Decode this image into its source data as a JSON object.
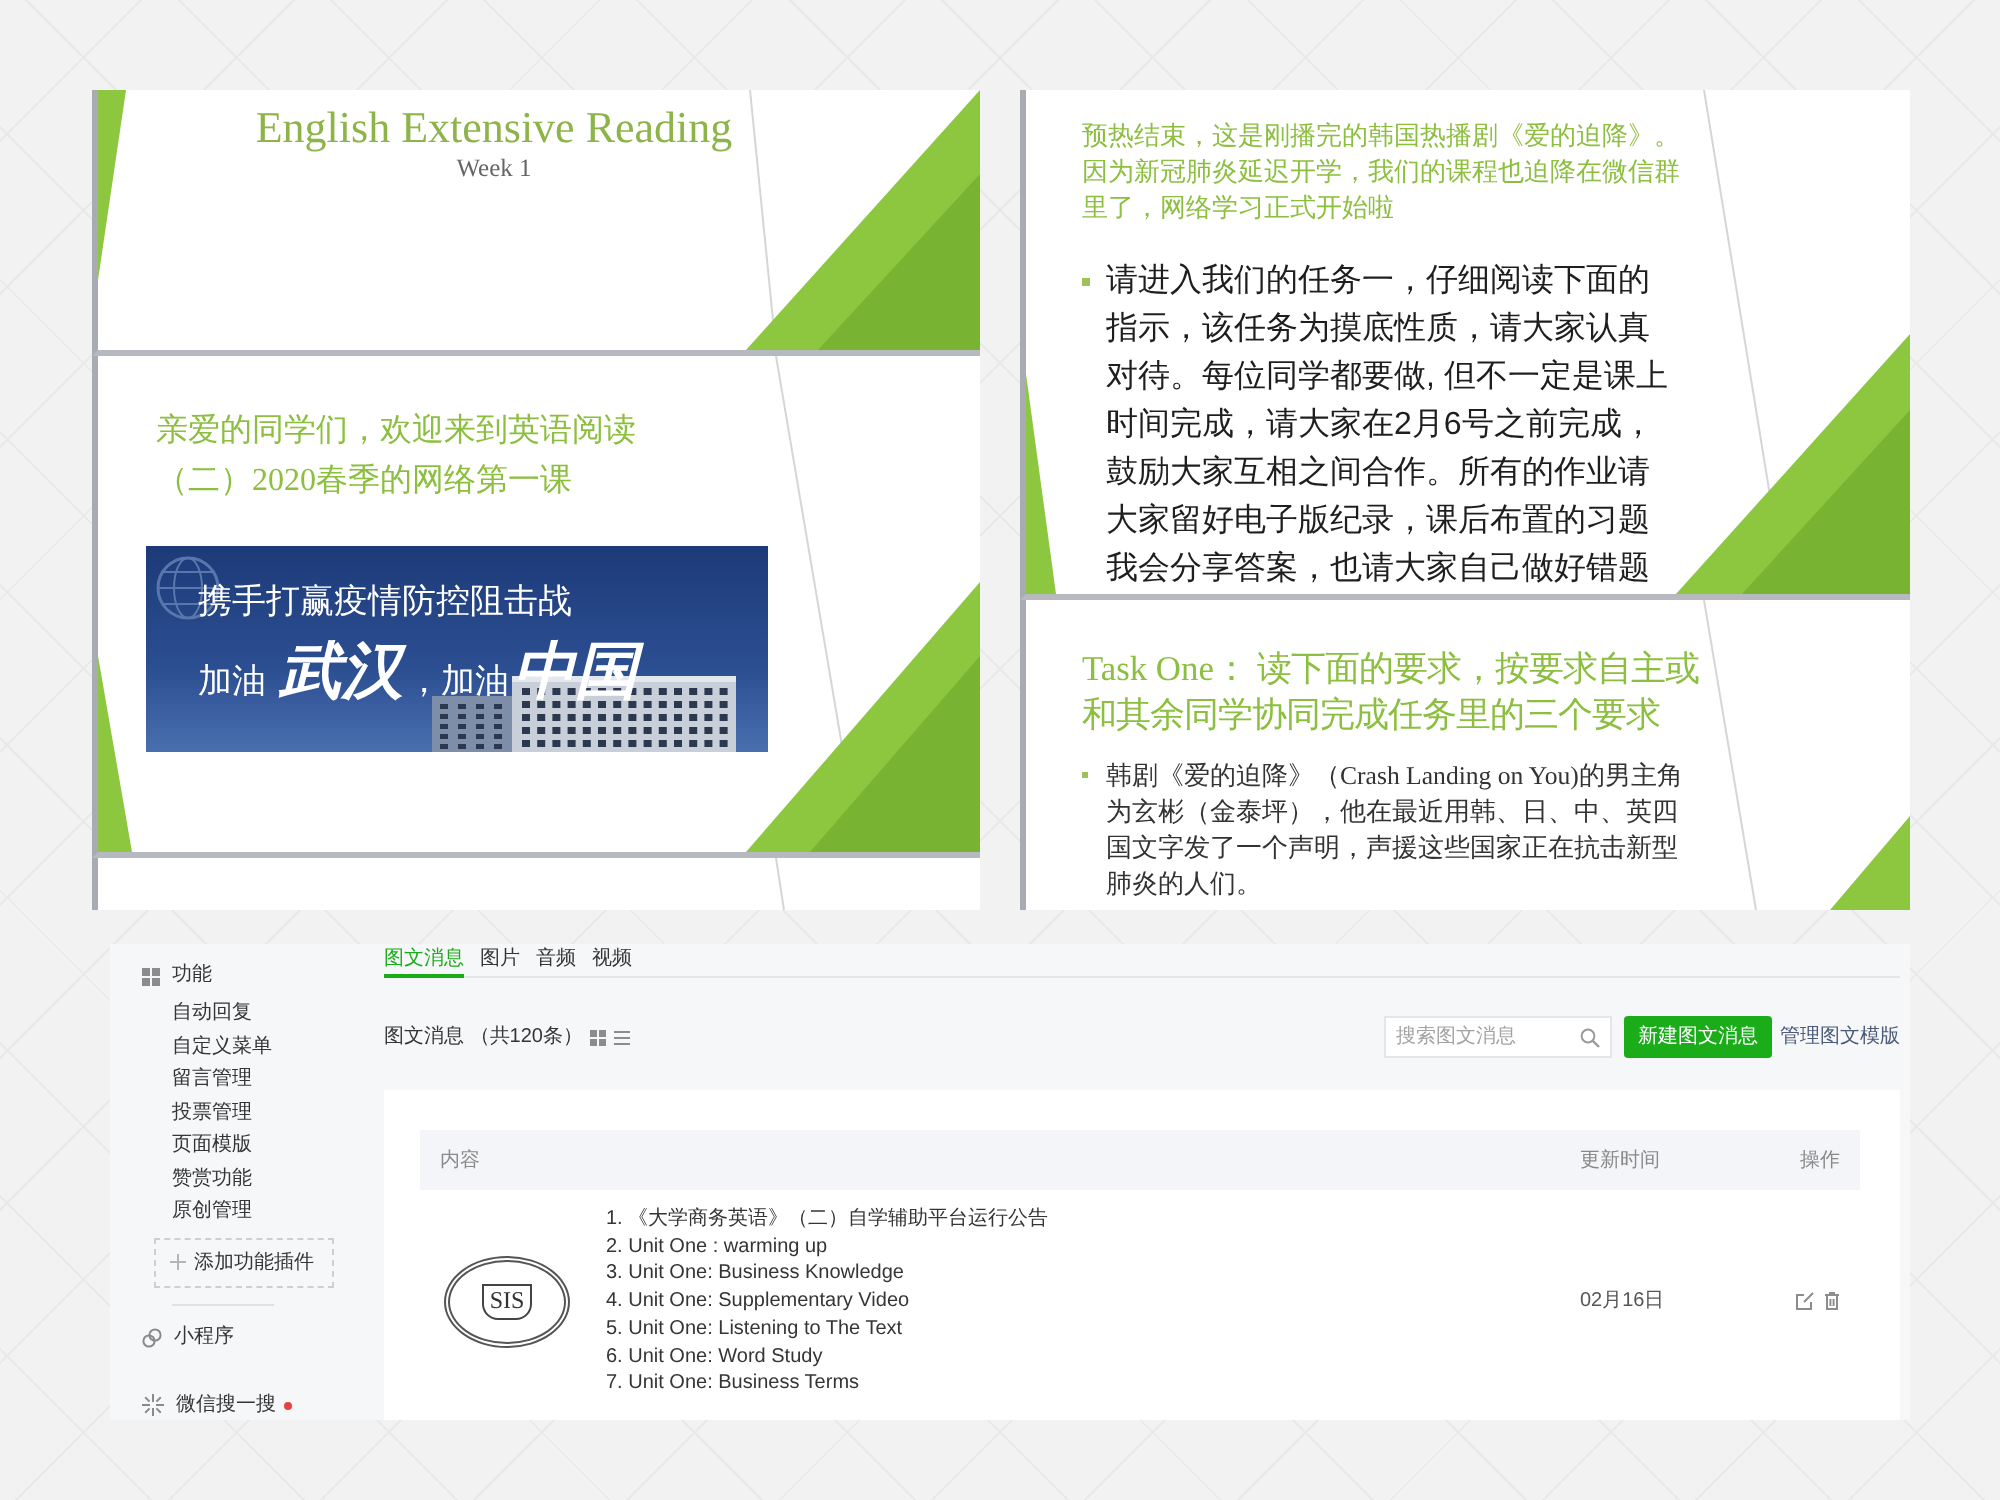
{
  "left_slides": [
    {
      "kind": "title",
      "title": "English Extensive Reading",
      "subtitle": "Week 1"
    },
    {
      "kind": "heading_banner",
      "heading": "亲爱的同学们，欢迎来到英语阅读（二）2020春季的网络第一课",
      "banner": {
        "line_1": "携手打赢疫情防控阻击战",
        "line_2": "加油 **武汉**，加油**中国**"
      }
    },
    {
      "kind": "blank"
    }
  ],
  "right_slides": [
    {
      "kind": "intro_bullets",
      "intro": "预热结束，这是刚播完的韩国热播剧《爱的迫降》。因为新冠肺炎延迟开学，我们的课程也迫降在微信群里了，网络学习正式开始啦",
      "bullets": [
        "请进入我们的任务一，仔细阅读下面的指示，该任务为摸底性质，请大家认真对待。每位同学都要做, 但不一定是课上时间完成，请大家在2月6号之前完成，鼓励大家互相之间合作。所有的作业请大家留好电子版纪录，课后布置的习题我会分享答案，也请大家自己做好错题"
      ]
    },
    {
      "kind": "title_bullets",
      "title": "Task One： 读下面的要求，按要求自主或和其余同学协同完成任务里的三个要求",
      "bullets": [
        "韩剧《爱的迫降》（Crash Landing on You)的男主角为玄彬（金泰坪），他在最近用韩、日、中、英四国文字发了一个声明，声援这些国家正在抗击新型肺炎的人们。"
      ]
    }
  ],
  "admin": {
    "sidebar": {
      "section": "功能",
      "items": [
        "自动回复",
        "自定义菜单",
        "留言管理",
        "投票管理",
        "页面模版",
        "赞赏功能",
        "原创管理"
      ],
      "add_plugin": "添加功能插件",
      "links": [
        {
          "kind": "mini_program",
          "label": "小程序",
          "notice": false
        },
        {
          "kind": "search",
          "label": "微信搜一搜",
          "notice": true
        }
      ]
    },
    "tabs": [
      {
        "label": "图文消息",
        "selected": true
      },
      {
        "label": "图片",
        "selected": false
      },
      {
        "label": "音频",
        "selected": false
      },
      {
        "label": "视频",
        "selected": false
      }
    ],
    "list_title": "图文消息 （共120条）",
    "search": {
      "placeholder": "搜索图文消息"
    },
    "new_button": "新建图文消息",
    "template_link": "管理图文模版",
    "table": {
      "columns": [
        "内容",
        "更新时间",
        "操作"
      ],
      "rows": [
        {
          "emblem": "SIS",
          "items": [
            "1. 《大学商务英语》（二）自学辅助平台运行公告",
            "2. Unit One : warming up",
            "3. Unit One: Business Knowledge",
            "4. Unit One: Supplementary Video",
            "5. Unit One: Listening to The Text",
            "6. Unit One: Word Study",
            "7. Unit One: Business Terms"
          ],
          "updated": "02月16日"
        }
      ]
    }
  }
}
